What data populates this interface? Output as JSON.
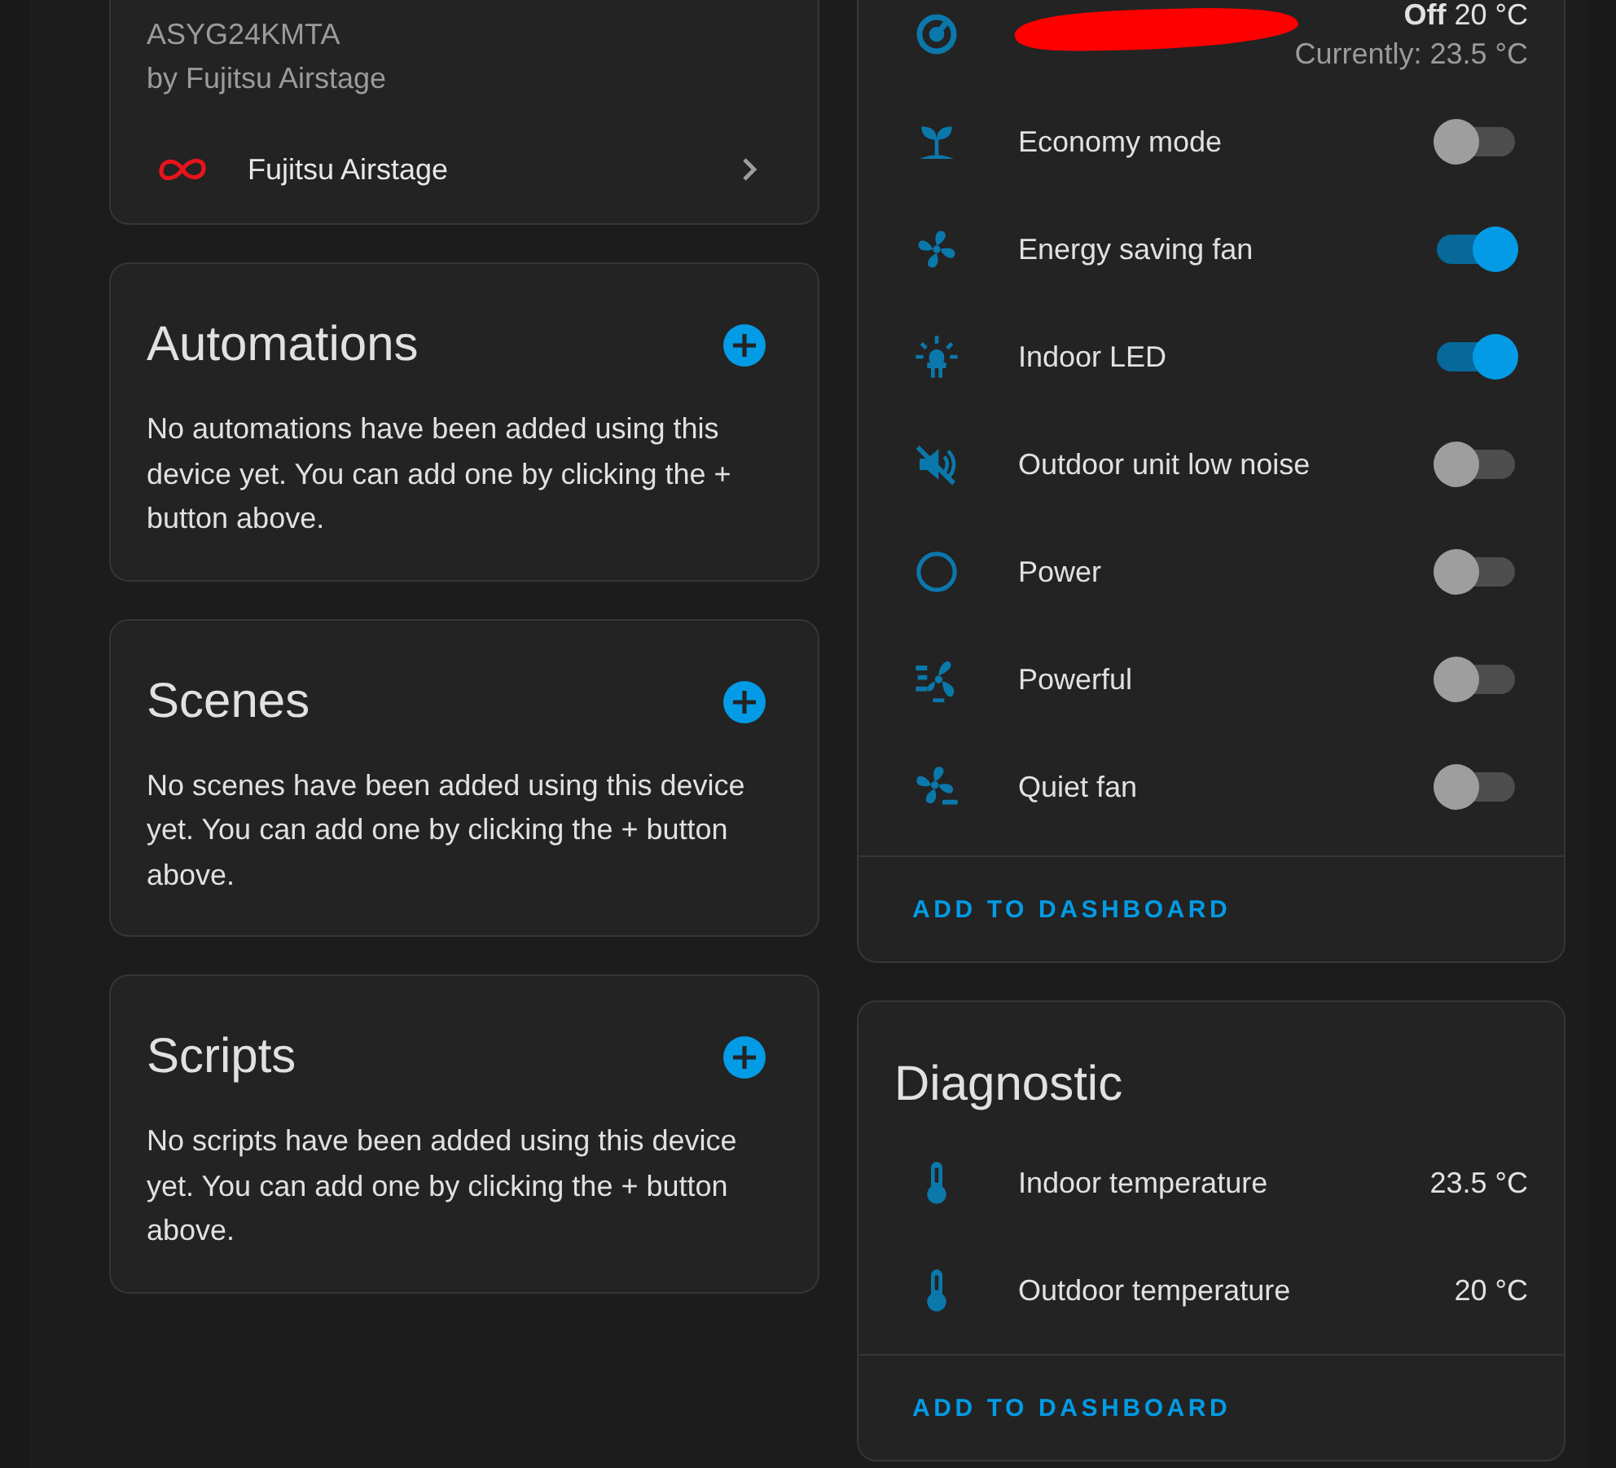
{
  "device_info": {
    "model": "ASYG24KMTA",
    "manufacturer": "by Fujitsu Airstage",
    "integration": {
      "name": "Fujitsu Airstage"
    }
  },
  "sections": [
    {
      "title": "Automations",
      "text": "No automations have been added using this device yet. You can add one by clicking the + button above."
    },
    {
      "title": "Scenes",
      "text": "No scenes have been added using this device yet. You can add one by clicking the + button above."
    },
    {
      "title": "Scripts",
      "text": "No scripts have been added using this device yet. You can add one by clicking the + button above."
    }
  ],
  "controls": {
    "entities": [
      {
        "kind": "climate",
        "redacted": true,
        "state": "**Off** 20 °C",
        "secondary": "Currently: 23.5 °C"
      },
      {
        "kind": "switch",
        "name": "Economy mode",
        "on": false
      },
      {
        "kind": "switch",
        "name": "Energy saving fan",
        "on": true
      },
      {
        "kind": "switch",
        "name": "Indoor LED",
        "on": true
      },
      {
        "kind": "switch",
        "name": "Outdoor unit low noise",
        "on": false
      },
      {
        "kind": "switch",
        "name": "Power",
        "on": false
      },
      {
        "kind": "switch",
        "name": "Powerful",
        "on": false
      },
      {
        "kind": "switch",
        "name": "Quiet fan",
        "on": false
      }
    ],
    "action": "ADD TO DASHBOARD"
  },
  "diagnostic": {
    "title": "Diagnostic",
    "entities": [
      {
        "kind": "sensor",
        "name": "Indoor temperature",
        "value": "23.5 °C"
      },
      {
        "kind": "sensor",
        "name": "Outdoor temperature",
        "value": "20 °C"
      }
    ],
    "action": "ADD TO DASHBOARD"
  }
}
